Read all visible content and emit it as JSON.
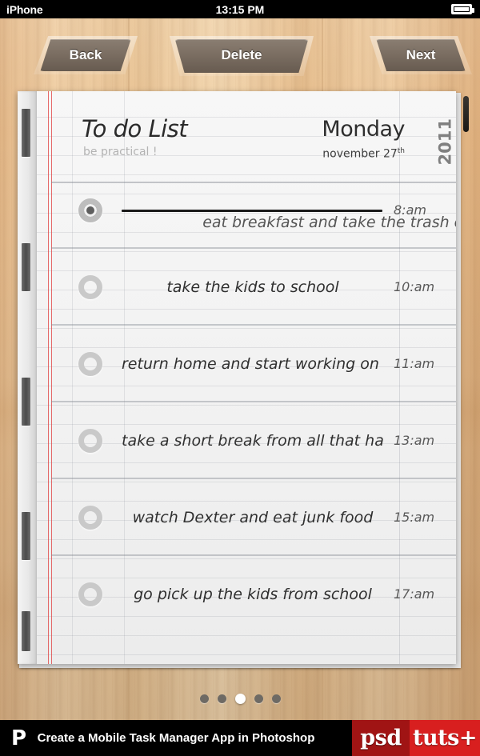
{
  "status_bar": {
    "carrier": "iPhone",
    "time": "13:15 PM",
    "battery_icon": "battery-full-icon"
  },
  "toolbar": {
    "back_label": "Back",
    "delete_label": "Delete",
    "next_label": "Next"
  },
  "paper": {
    "title": "To do List",
    "subtitle": "be practical !",
    "weekday": "Monday",
    "month_day": "november 27",
    "day_suffix": "th",
    "year": "2011"
  },
  "tasks": [
    {
      "text": "eat breakfast and take the trash out",
      "time": "8:am",
      "done": true
    },
    {
      "text": "take the kids to school",
      "time": "10:am",
      "done": false
    },
    {
      "text": "return home and start working on projects",
      "time": "11:am",
      "done": false
    },
    {
      "text": "take a short break from all that hard work",
      "time": "13:am",
      "done": false
    },
    {
      "text": "watch Dexter and eat junk food",
      "time": "15:am",
      "done": false
    },
    {
      "text": "go pick up the kids from school",
      "time": "17:am",
      "done": false
    }
  ],
  "pagination": {
    "total": 5,
    "active_index": 2
  },
  "footer": {
    "mark": "P",
    "text": "Create a Mobile Task Manager App in Photoshop",
    "logo_first": "psd",
    "logo_second": "tuts+"
  },
  "colors": {
    "accent_red": "#d81f1f",
    "logo_dark_red": "#a01414",
    "paper": "#f2f2f2",
    "button": "#7d7064",
    "margin_line_red": "#e14646"
  }
}
